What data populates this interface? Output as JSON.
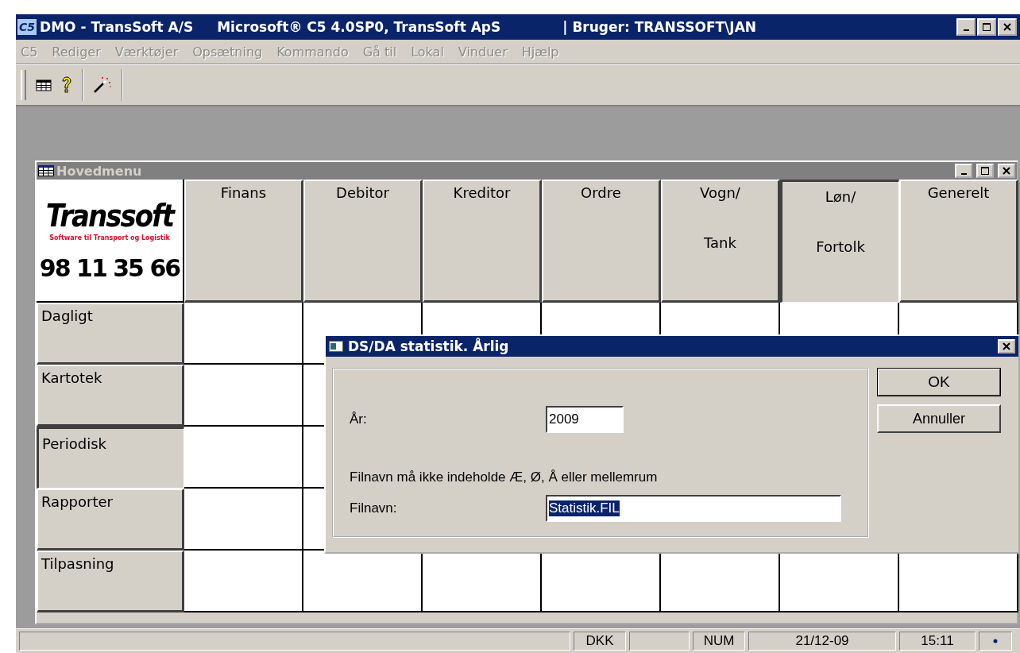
{
  "window": {
    "title_parts": [
      "DMO - TransSoft A/S",
      "Microsoft® C5 4.0SP0, TransSoft ApS",
      "| Bruger: TRANSSOFT\\JAN"
    ],
    "app_icon": "C5"
  },
  "menu": [
    {
      "label": "C5",
      "disabled": true
    },
    {
      "label": "Rediger",
      "disabled": true
    },
    {
      "label": "Værktøjer",
      "disabled": true
    },
    {
      "label": "Opsætning",
      "disabled": true
    },
    {
      "label": "Kommando",
      "disabled": true
    },
    {
      "label": "Gå til",
      "disabled": true
    },
    {
      "label": "Lokal",
      "disabled": true
    },
    {
      "label": "Vinduer",
      "disabled": true
    },
    {
      "label": "Hjælp",
      "disabled": true
    }
  ],
  "main_menu": {
    "title": "Hovedmenu",
    "logo": {
      "name": "Transsoft",
      "tagline": "Software til Transport og Logistik",
      "phone": "98 11 35 66"
    },
    "columns": [
      {
        "lines": [
          "Finans"
        ],
        "selected": false
      },
      {
        "lines": [
          "Debitor"
        ],
        "selected": false
      },
      {
        "lines": [
          "Kreditor"
        ],
        "selected": false
      },
      {
        "lines": [
          "Ordre"
        ],
        "selected": false
      },
      {
        "lines": [
          "Vogn/",
          "Tank"
        ],
        "selected": false
      },
      {
        "lines": [
          "Løn/",
          "Fortolk"
        ],
        "selected": true
      },
      {
        "lines": [
          "Generelt"
        ],
        "selected": false
      }
    ],
    "rows": [
      {
        "label": "Dagligt",
        "selected": false
      },
      {
        "label": "Kartotek",
        "selected": false
      },
      {
        "label": "Periodisk",
        "selected": true
      },
      {
        "label": "Rapporter",
        "selected": false
      },
      {
        "label": "Tilpasning",
        "selected": false
      }
    ]
  },
  "dialog": {
    "title": "DS/DA statistik. Årlig",
    "year_label": "År:",
    "year_value": "2009",
    "note": "Filnavn må ikke indeholde Æ, Ø, Å eller mellemrum",
    "file_label": "Filnavn:",
    "file_value": "Statistik.FIL",
    "buttons": [
      "OK",
      "Annuller"
    ]
  },
  "status_bar": [
    "DKK",
    "NUM",
    "21/12-09",
    "15:11"
  ]
}
